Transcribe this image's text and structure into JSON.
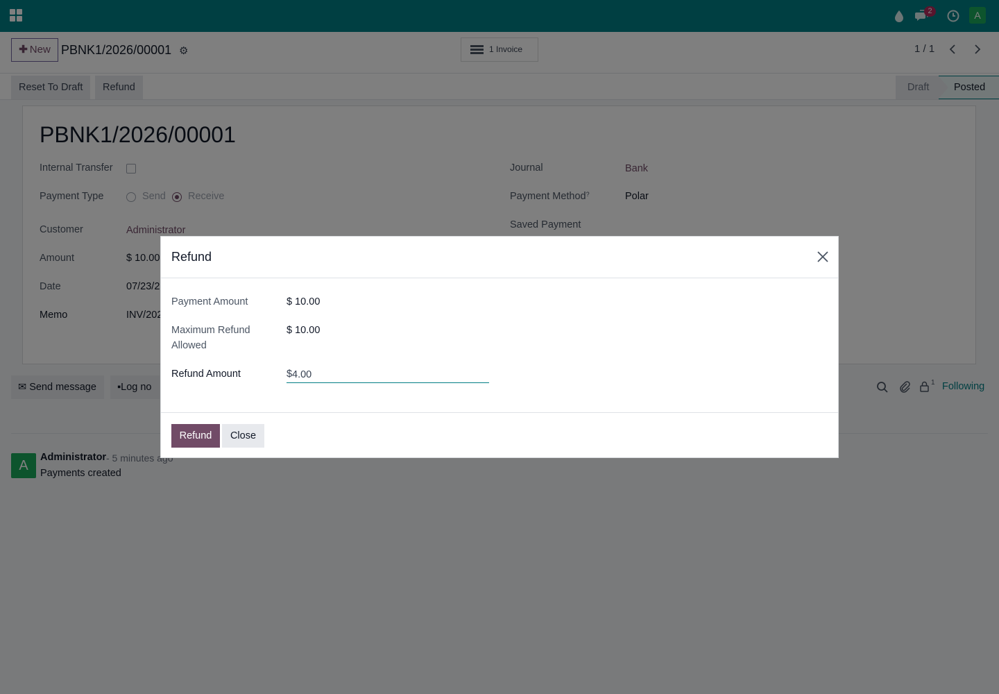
{
  "navbar": {
    "icons": [
      "apps-grid-icon",
      "droplet-icon",
      "chat-bubbles-icon",
      "clock-icon"
    ],
    "messages_badge": "2",
    "avatar_letter": "A",
    "colors": {
      "navbar": "#017e84",
      "accent": "#714b67",
      "avatar": "#1aa85a"
    }
  },
  "control": {
    "new_label": "New",
    "record_name": "PBNK1/2026/00001",
    "smart_button": "1 Invoice",
    "pager": "1 / 1"
  },
  "statusbar": {
    "buttons": [
      "Reset To Draft",
      "Refund"
    ],
    "stages": [
      "Draft",
      "Posted"
    ],
    "active_stage": "Posted"
  },
  "form": {
    "title": "PBNK1/2026/00001",
    "internal_transfer_label": "Internal Transfer",
    "payment_type_label": "Payment Type",
    "payment_type_options": [
      "Send",
      "Receive"
    ],
    "payment_type_selected": "Receive",
    "customer_label": "Customer",
    "customer_value": "Administrator",
    "amount_label": "Amount",
    "amount_value": "$ 10.00",
    "date_label": "Date",
    "date_value": "07/23/2",
    "memo_label": "Memo",
    "memo_value": "INV/202",
    "journal_label": "Journal",
    "journal_value": "Bank",
    "payment_method_label": "Payment Method",
    "payment_method_sup": "?",
    "payment_method_value": "Polar",
    "saved_payment_label": "Saved Payment"
  },
  "chatter": {
    "send_message": "Send message",
    "log_note": "Log no",
    "followers_count": "1",
    "following": "Following",
    "message": {
      "author": "Administrator",
      "time": "- 5 minutes ago",
      "body": "Payments created",
      "avatar_letter": "A"
    }
  },
  "modal": {
    "title": "Refund",
    "payment_amount_label": "Payment Amount",
    "payment_amount_value": "$ 10.00",
    "max_refund_label_line1": "Maximum Refund",
    "max_refund_label_line2": "Allowed",
    "max_refund_value": "$ 10.00",
    "refund_amount_label": "Refund Amount",
    "refund_currency": "$",
    "refund_amount_value": "4.00",
    "refund_button": "Refund",
    "close_button": "Close"
  }
}
